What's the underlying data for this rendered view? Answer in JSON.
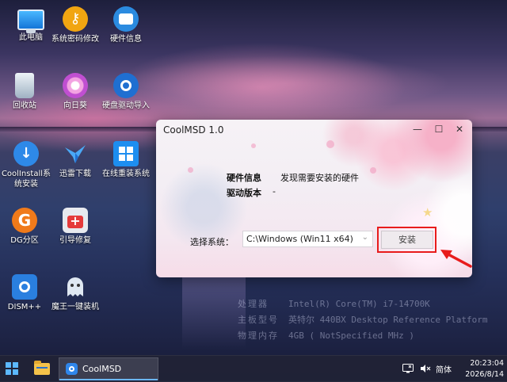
{
  "desktop": {
    "icons": [
      {
        "label": "此电脑",
        "icon": "computer-icon"
      },
      {
        "label": "系统密码修改",
        "icon": "key-icon"
      },
      {
        "label": "硬件信息",
        "icon": "hardware-info-icon"
      },
      {
        "label": "回收站",
        "icon": "recycle-bin-icon"
      },
      {
        "label": "向日葵",
        "icon": "sunflower-icon"
      },
      {
        "label": "硬盘驱动导入",
        "icon": "disk-driver-icon"
      },
      {
        "label": "CoolInstall系统安装",
        "icon": "download-arrow-icon"
      },
      {
        "label": "迅雷下载",
        "icon": "thunder-bird-icon"
      },
      {
        "label": "在线重装系统",
        "icon": "windows-icon"
      },
      {
        "label": "DG分区",
        "icon": "dg-partition-icon"
      },
      {
        "label": "引导修复",
        "icon": "first-aid-icon"
      },
      {
        "label": "DISM++",
        "icon": "dism-gear-icon"
      },
      {
        "label": "魔王一键装机",
        "icon": "ghost-icon"
      }
    ],
    "sysinfo": [
      {
        "key": "处理器",
        "value": "Intel(R) Core(TM) i7-14700K"
      },
      {
        "key": "主板型号",
        "value": "英特尔 440BX Desktop Reference Platform"
      },
      {
        "key": "物理内存",
        "value": "4GB ( NotSpecified  MHz )"
      }
    ]
  },
  "window": {
    "title": "CoolMSD 1.0",
    "controls": {
      "minimize": "—",
      "maximize": "☐",
      "close": "✕"
    },
    "hardware_label": "硬件信息",
    "hardware_value": "发现需要安装的硬件",
    "driver_label": "驱动版本",
    "driver_value": "-",
    "select_label": "选择系统：",
    "select_value": "C:\\Windows (Win11 x64)",
    "install_button": "安装"
  },
  "annotation": {
    "highlight_color": "#e81c1c"
  },
  "taskbar": {
    "app_name": "CoolMSD",
    "ime": "简体",
    "time": "20:23:04",
    "date": "2026/8/14"
  }
}
